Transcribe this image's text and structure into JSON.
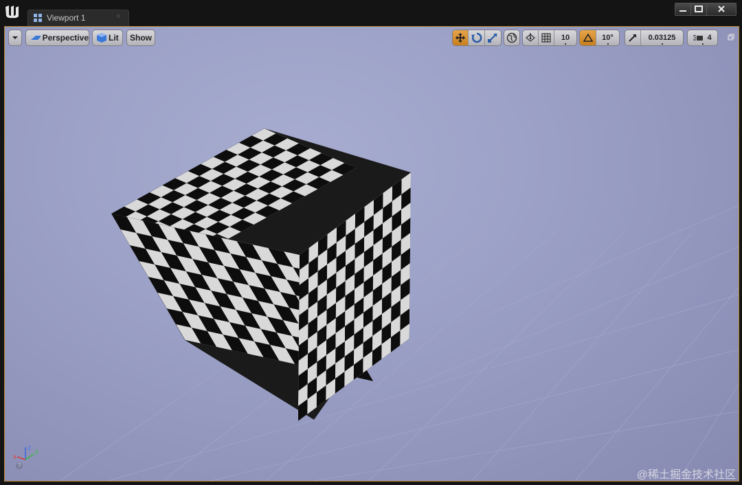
{
  "window": {
    "tab_label": "Viewport 1",
    "tab_close": "×"
  },
  "toolbar": {
    "menu_icon": "chevron-down-icon",
    "view_mode_label": "Perspective",
    "lighting_label": "Lit",
    "show_label": "Show",
    "grid_snap_value": "10",
    "rotation_snap_value": "10°",
    "scale_snap_value": "0.03125",
    "camera_speed_value": "4",
    "active_transform": "translate"
  },
  "axis_gizmo": {
    "x_label": "x",
    "y_label": "y",
    "z_label": "z"
  },
  "help_glyph": "?",
  "watermark": "@稀土掘金技术社区",
  "colors": {
    "accent": "#e39b3a",
    "viewport_border": "#b8862a",
    "background": "#9da2c8"
  }
}
